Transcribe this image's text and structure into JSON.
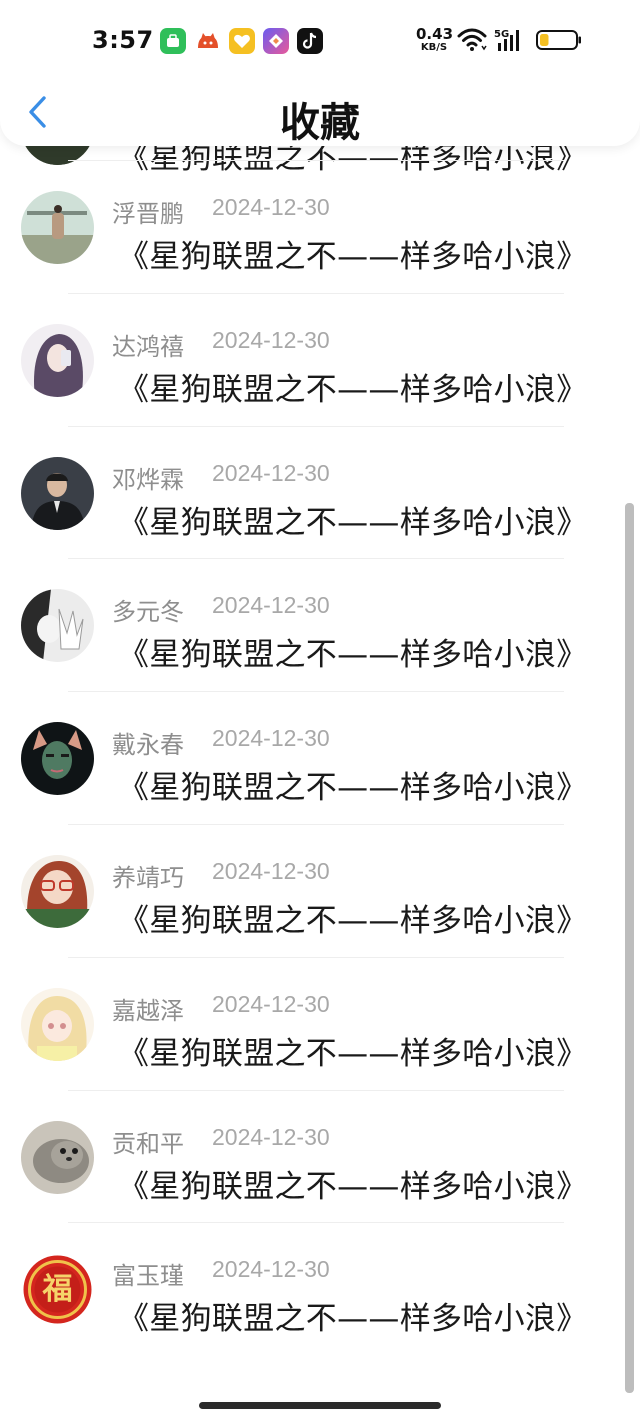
{
  "status_bar": {
    "time": "3:57",
    "net_speed_value": "0.43",
    "net_speed_unit": "KB/S",
    "cell_label": "5G",
    "app_icons": [
      "green-app-icon",
      "orange-cat-app-icon",
      "yellow-heart-app-icon",
      "purple-app-icon",
      "tiktok-icon"
    ],
    "battery_level": 0.25
  },
  "nav": {
    "title": "收藏",
    "accent": "#3a8ee6"
  },
  "items": [
    {
      "name": "",
      "date": "",
      "title": "《星狗联盟之不——样多哈小浪》",
      "avatar": "dark-landscape"
    },
    {
      "name": "浮晋鹏",
      "date": "2024-12-30",
      "title": "《星狗联盟之不——样多哈小浪》",
      "avatar": "person-outdoor"
    },
    {
      "name": "达鸿禧",
      "date": "2024-12-30",
      "title": "《星狗联盟之不——样多哈小浪》",
      "avatar": "girl-purple-hair"
    },
    {
      "name": "邓烨霖",
      "date": "2024-12-30",
      "title": "《星狗联盟之不——样多哈小浪》",
      "avatar": "man-suit"
    },
    {
      "name": "多元冬",
      "date": "2024-12-30",
      "title": "《星狗联盟之不——样多哈小浪》",
      "avatar": "bw-hand"
    },
    {
      "name": "戴永春",
      "date": "2024-12-30",
      "title": "《星狗联盟之不——样多哈小浪》",
      "avatar": "cat-ears-face"
    },
    {
      "name": "养靖巧",
      "date": "2024-12-30",
      "title": "《星狗联盟之不——样多哈小浪》",
      "avatar": "glasses-girl"
    },
    {
      "name": "嘉越泽",
      "date": "2024-12-30",
      "title": "《星狗联盟之不——样多哈小浪》",
      "avatar": "anime-girl"
    },
    {
      "name": "贡和平",
      "date": "2024-12-30",
      "title": "《星狗联盟之不——样多哈小浪》",
      "avatar": "seal"
    },
    {
      "name": "富玉瑾",
      "date": "2024-12-30",
      "title": "《星狗联盟之不——样多哈小浪》",
      "avatar": "fu-character"
    }
  ]
}
